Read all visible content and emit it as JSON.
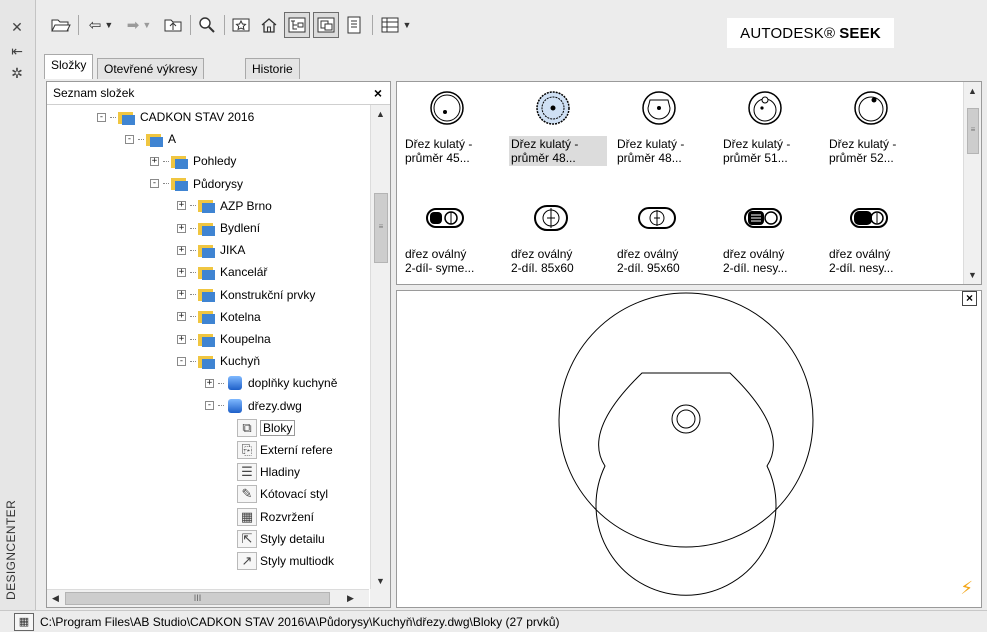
{
  "window": {
    "vertical_title": "DESIGNCENTER",
    "side_icons": [
      "close-icon",
      "pin-icon",
      "properties-icon"
    ]
  },
  "toolbar": {
    "buttons": [
      "load-icon",
      "back-icon",
      "forward-icon",
      "up-icon",
      "search-icon",
      "favorites-icon",
      "home-icon",
      "tree-view-toggle-icon",
      "preview-toggle-icon",
      "description-toggle-icon",
      "views-icon"
    ],
    "brand": "AUTODESK®",
    "brand_bold": "SEEK"
  },
  "tabs": [
    {
      "label": "Složky",
      "active": true
    },
    {
      "label": "Otevřené výkresy",
      "active": false
    },
    {
      "label": "Historie",
      "active": false
    }
  ],
  "tree": {
    "header": "Seznam složek",
    "close": "×",
    "items": [
      {
        "label": "CADKON STAV 2016",
        "kind": "folder",
        "expander": "−"
      },
      {
        "label": "A",
        "kind": "folder",
        "expander": "−"
      },
      {
        "label": "Pohledy",
        "kind": "folder",
        "expander": "+"
      },
      {
        "label": "Půdorysy",
        "kind": "folder",
        "expander": "−"
      },
      {
        "label": "AZP Brno",
        "kind": "folder",
        "expander": "+"
      },
      {
        "label": "Bydlení",
        "kind": "folder",
        "expander": "+"
      },
      {
        "label": "JIKA",
        "kind": "folder",
        "expander": "+"
      },
      {
        "label": "Kancelář",
        "kind": "folder",
        "expander": "+"
      },
      {
        "label": "Konstrukční prvky",
        "kind": "folder",
        "expander": "+"
      },
      {
        "label": "Kotelna",
        "kind": "folder",
        "expander": "+"
      },
      {
        "label": "Koupelna",
        "kind": "folder",
        "expander": "+"
      },
      {
        "label": "Kuchyň",
        "kind": "folder",
        "expander": "−"
      },
      {
        "label": "doplňky kuchyně",
        "kind": "drawing",
        "expander": "+"
      },
      {
        "label": "dřezy.dwg",
        "kind": "drawing",
        "expander": "−"
      },
      {
        "label": "Bloky",
        "kind": "leaf",
        "icon": "blocks-icon",
        "selected": true
      },
      {
        "label": "Externí refere",
        "kind": "leaf",
        "icon": "xref-icon"
      },
      {
        "label": "Hladiny",
        "kind": "leaf",
        "icon": "layers-icon"
      },
      {
        "label": "Kótovací styl",
        "kind": "leaf",
        "icon": "dimstyle-icon"
      },
      {
        "label": "Rozvržení",
        "kind": "leaf",
        "icon": "layout-icon"
      },
      {
        "label": "Styly detailu",
        "kind": "leaf",
        "icon": "detail-style-icon"
      },
      {
        "label": "Styly multiodk",
        "kind": "leaf",
        "icon": "mleader-style-icon"
      }
    ],
    "hscroll_grip": "III"
  },
  "thumbnails": [
    {
      "line1": "Dřez kulatý -",
      "line2": "průměr 45...",
      "shape": "round-a",
      "selected": false
    },
    {
      "line1": "Dřez kulatý -",
      "line2": "průměr 48...",
      "shape": "round-b",
      "selected": true
    },
    {
      "line1": "Dřez kulatý -",
      "line2": "průměr 48...",
      "shape": "round-c",
      "selected": false
    },
    {
      "line1": "Dřez kulatý -",
      "line2": "průměr 51...",
      "shape": "round-d",
      "selected": false
    },
    {
      "line1": "Dřez kulatý -",
      "line2": "průměr 52...",
      "shape": "round-e",
      "selected": false
    },
    {
      "line1": "dřez oválný",
      "line2": "2-díl- syme...",
      "shape": "oval-a",
      "selected": false
    },
    {
      "line1": "dřez oválný",
      "line2": "2-díl. 85x60",
      "shape": "oval-b",
      "selected": false
    },
    {
      "line1": "dřez oválný",
      "line2": "2-díl. 95x60",
      "shape": "oval-c",
      "selected": false
    },
    {
      "line1": "dřez oválný",
      "line2": "2-díl. nesy...",
      "shape": "oval-d",
      "selected": false
    },
    {
      "line1": "dřez oválný",
      "line2": "2-díl. nesy...",
      "shape": "oval-e",
      "selected": false
    }
  ],
  "preview": {
    "close": "×",
    "status_icon": "lightning-icon"
  },
  "status": {
    "icon": "folder-view-icon",
    "path": "C:\\Program Files\\AB Studio\\CADKON STAV 2016\\A\\Půdorysy\\Kuchyň\\dřezy.dwg\\Bloky (27 prvků)"
  }
}
